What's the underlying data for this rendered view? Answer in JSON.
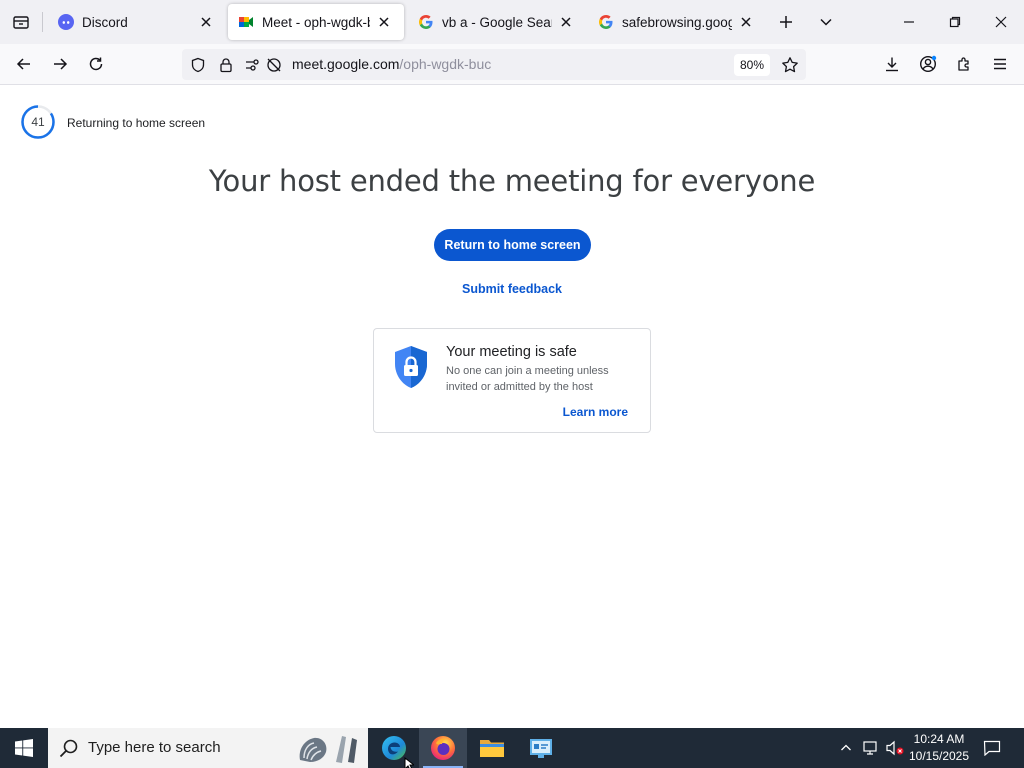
{
  "browser": {
    "tabs": [
      {
        "title": "Discord",
        "favicon": "discord-icon",
        "active": false
      },
      {
        "title": "Meet - oph-wgdk-buc",
        "favicon": "google-meet-icon",
        "active": true
      },
      {
        "title": "vb a - Google Search",
        "favicon": "google-icon",
        "active": false
      },
      {
        "title": "safebrowsing.google.com",
        "favicon": "google-icon",
        "active": false
      }
    ],
    "url": {
      "host": "meet.google.com",
      "path": "/oph-wgdk-buc"
    },
    "zoom": "80%"
  },
  "page": {
    "countdown": {
      "seconds": "41",
      "label": "Returning to home screen"
    },
    "headline": "Your host ended the meeting for everyone",
    "primary_button": "Return to home screen",
    "feedback_link": "Submit feedback",
    "safety_card": {
      "title": "Your meeting is safe",
      "body": "No one can join a meeting unless invited or admitted by the host",
      "link": "Learn more"
    }
  },
  "taskbar": {
    "search_placeholder": "Type here to search",
    "time": "10:24 AM",
    "date": "10/15/2025"
  },
  "colors": {
    "accent": "#0b57d0",
    "tab_strip": "#f0f0f4",
    "taskbar": "#1f2a37"
  }
}
